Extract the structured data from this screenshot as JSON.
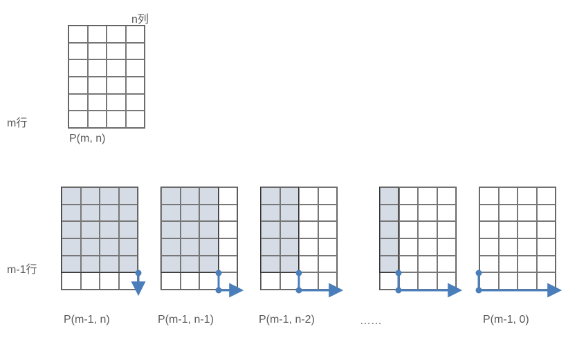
{
  "labels": {
    "n_col": "n列",
    "m_row": "m行",
    "m1_row": "m-1行",
    "p_mn": "P(m, n)",
    "p_m1n": "P(m-1, n)",
    "p_m1n1": "P(m-1, n-1)",
    "p_m1n2": "P(m-1, n-2)",
    "ellipsis": "……",
    "p_m10": "P(m-1, 0)"
  },
  "chart_data": {
    "type": "diagram",
    "description": "Recursive decomposition of lattice-path count P(m,n) on an m-row by n-column grid. The second row expands P(m,n) along the bottom row: the first step goes down into row m, then walks right k cells (k = 0..n), leaving an (m-1)×(n-k) sub-grid above-left (shaded). Hence P(m,n) = Σ_{k=0}^{n} P(m-1, n-k) = Σ_{j=0}^{n} P(m-1, j).",
    "grid_rows": 6,
    "grid_cols": 4,
    "top_grid": {
      "label": "P(m, n)",
      "rows": 6,
      "cols": 4
    },
    "bottom_grids": [
      {
        "label": "P(m-1, n)",
        "shaded_rows": 5,
        "shaded_cols": 4,
        "arrow_right_cells": 0
      },
      {
        "label": "P(m-1, n-1)",
        "shaded_rows": 5,
        "shaded_cols": 3,
        "arrow_right_cells": 1
      },
      {
        "label": "P(m-1, n-2)",
        "shaded_rows": 5,
        "shaded_cols": 2,
        "arrow_right_cells": 2
      },
      {
        "label": "……",
        "shaded_rows": 5,
        "shaded_cols": 1,
        "arrow_right_cells": 3
      },
      {
        "label": "P(m-1, 0)",
        "shaded_rows": 5,
        "shaded_cols": 0,
        "arrow_right_cells": 4
      }
    ],
    "arrow_color": "#4A7EBB"
  }
}
